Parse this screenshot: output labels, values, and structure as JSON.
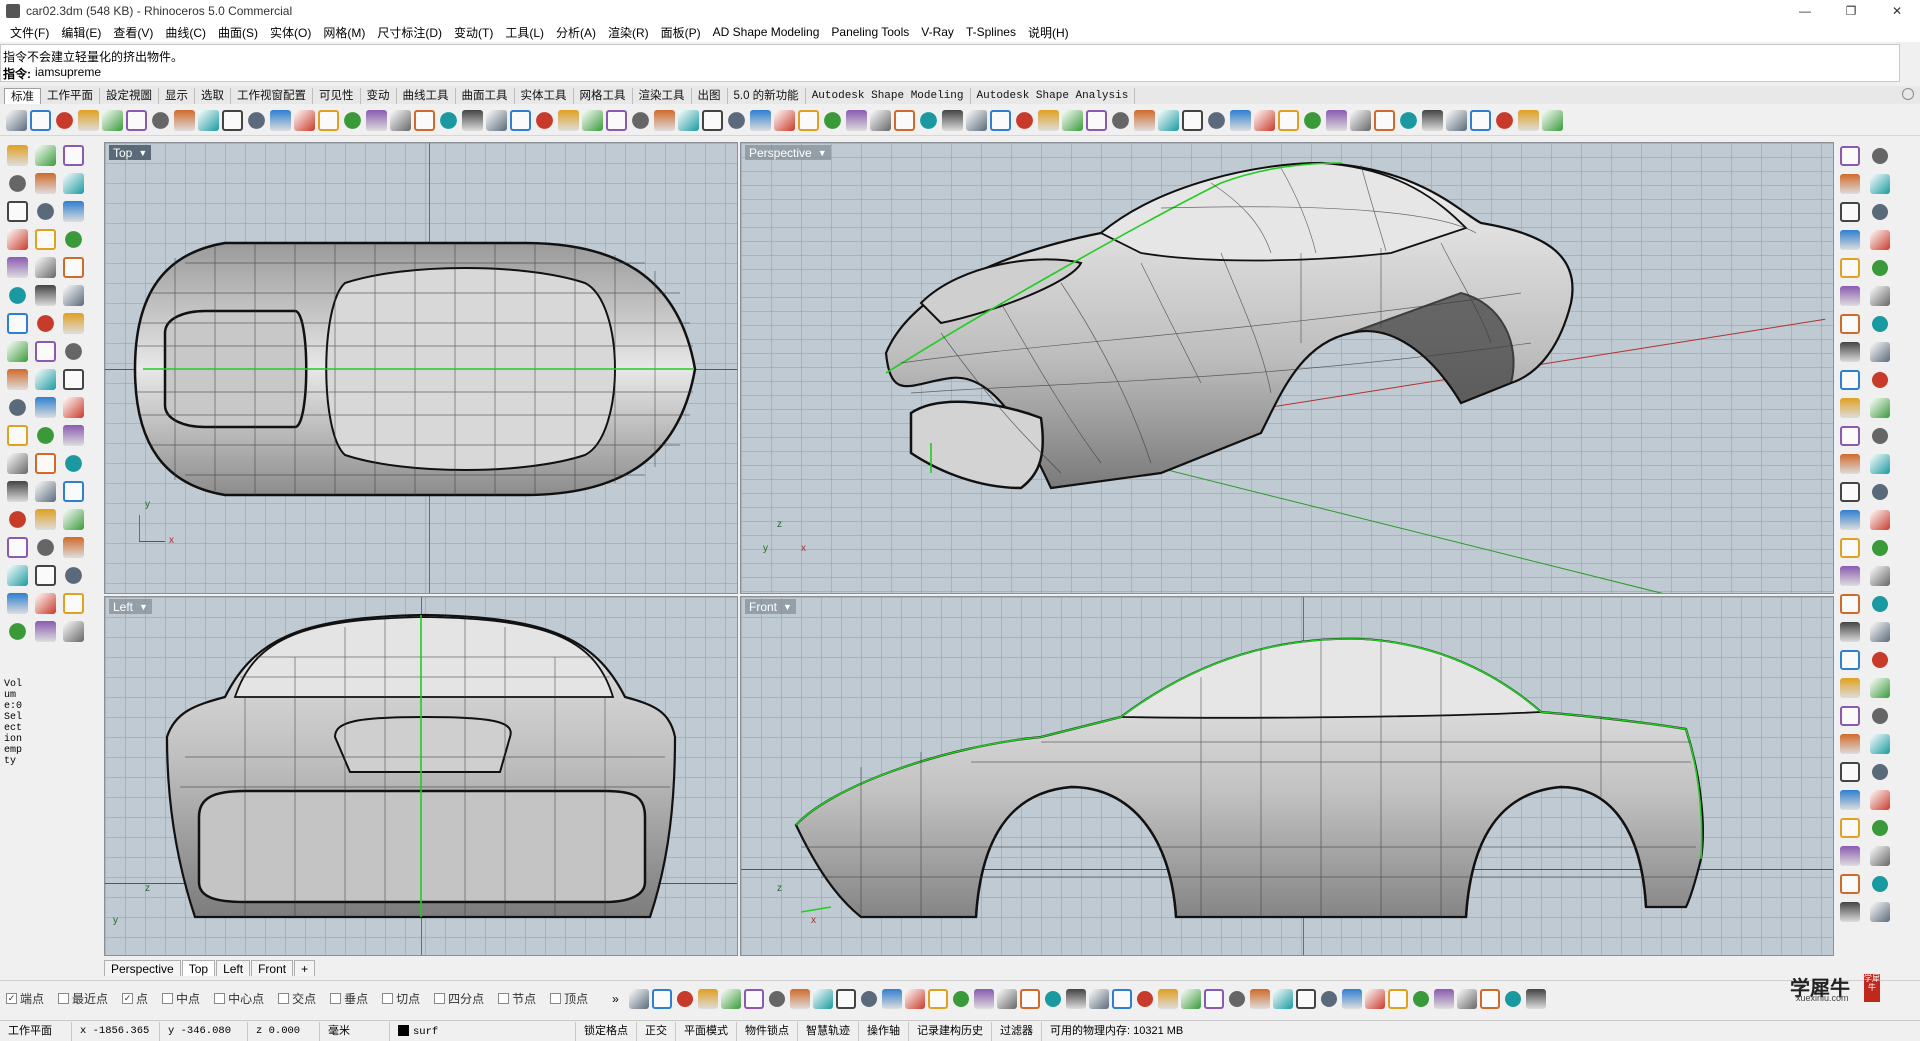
{
  "window": {
    "title": "car02.3dm (548 KB) - Rhinoceros 5.0 Commercial",
    "controls": [
      "—",
      "❐",
      "✕"
    ]
  },
  "menu": [
    "文件(F)",
    "编辑(E)",
    "查看(V)",
    "曲线(C)",
    "曲面(S)",
    "实体(O)",
    "网格(M)",
    "尺寸标注(D)",
    "变动(T)",
    "工具(L)",
    "分析(A)",
    "渲染(R)",
    "面板(P)",
    "AD Shape Modeling",
    "Paneling Tools",
    "V-Ray",
    "T-Splines",
    "说明(H)"
  ],
  "command": {
    "history": "指令不会建立轻量化的挤出物件。",
    "prompt_label": "指令:",
    "prompt_value": "iamsupreme"
  },
  "toolbar_tabs": [
    "标准",
    "工作平面",
    "設定視圖",
    "显示",
    "选取",
    "工作视窗配置",
    "可见性",
    "变动",
    "曲线工具",
    "曲面工具",
    "实体工具",
    "网格工具",
    "渲染工具",
    "出图",
    "5.0 的新功能",
    "Autodesk Shape Modeling",
    "Autodesk Shape Analysis"
  ],
  "viewports": {
    "top": {
      "label": "Top"
    },
    "perspective": {
      "label": "Perspective"
    },
    "left": {
      "label": "Left"
    },
    "front": {
      "label": "Front"
    }
  },
  "axis_labels": {
    "top": {
      "v": "y",
      "h": "x"
    },
    "perspective": {
      "z": "z",
      "y": "y",
      "x": "x"
    },
    "left": {
      "v": "z",
      "h": "y"
    },
    "front": {
      "v": "z",
      "h": "x"
    }
  },
  "left_panel_text": "Volume:0 Selection empty",
  "viewport_tabs": [
    "Perspective",
    "Top",
    "Left",
    "Front",
    "+"
  ],
  "osnaps": [
    {
      "label": "端点",
      "checked": true
    },
    {
      "label": "最近点",
      "checked": false
    },
    {
      "label": "点",
      "checked": true
    },
    {
      "label": "中点",
      "checked": false
    },
    {
      "label": "中心点",
      "checked": false
    },
    {
      "label": "交点",
      "checked": false
    },
    {
      "label": "垂点",
      "checked": false
    },
    {
      "label": "切点",
      "checked": false
    },
    {
      "label": "四分点",
      "checked": false
    },
    {
      "label": "节点",
      "checked": false
    },
    {
      "label": "顶点",
      "checked": false
    }
  ],
  "osnap_more": "»",
  "status": {
    "cplane": "工作平面",
    "x": "x -1856.365",
    "y": "y -346.080",
    "z": "z 0.000",
    "units": "毫米",
    "layer": "surf",
    "grid_snap": "锁定格点",
    "ortho": "正交",
    "planar": "平面模式",
    "osnap": "物件锁点",
    "smarttrack": "智慧轨迹",
    "gumball": "操作轴",
    "history": "记录建构历史",
    "filter": "过滤器",
    "memory": "可用的物理内存: 10321 MB"
  },
  "watermark": {
    "main": "学犀牛",
    "sub": "xuexiniu.com",
    "seal": "学犀牛"
  },
  "colors": {
    "viewport_bg": "#bfcad2",
    "axis_x": "#b03030",
    "axis_y": "#2a9a2a",
    "selected_curve": "#22cc22",
    "active_label": "#5a6a78"
  }
}
